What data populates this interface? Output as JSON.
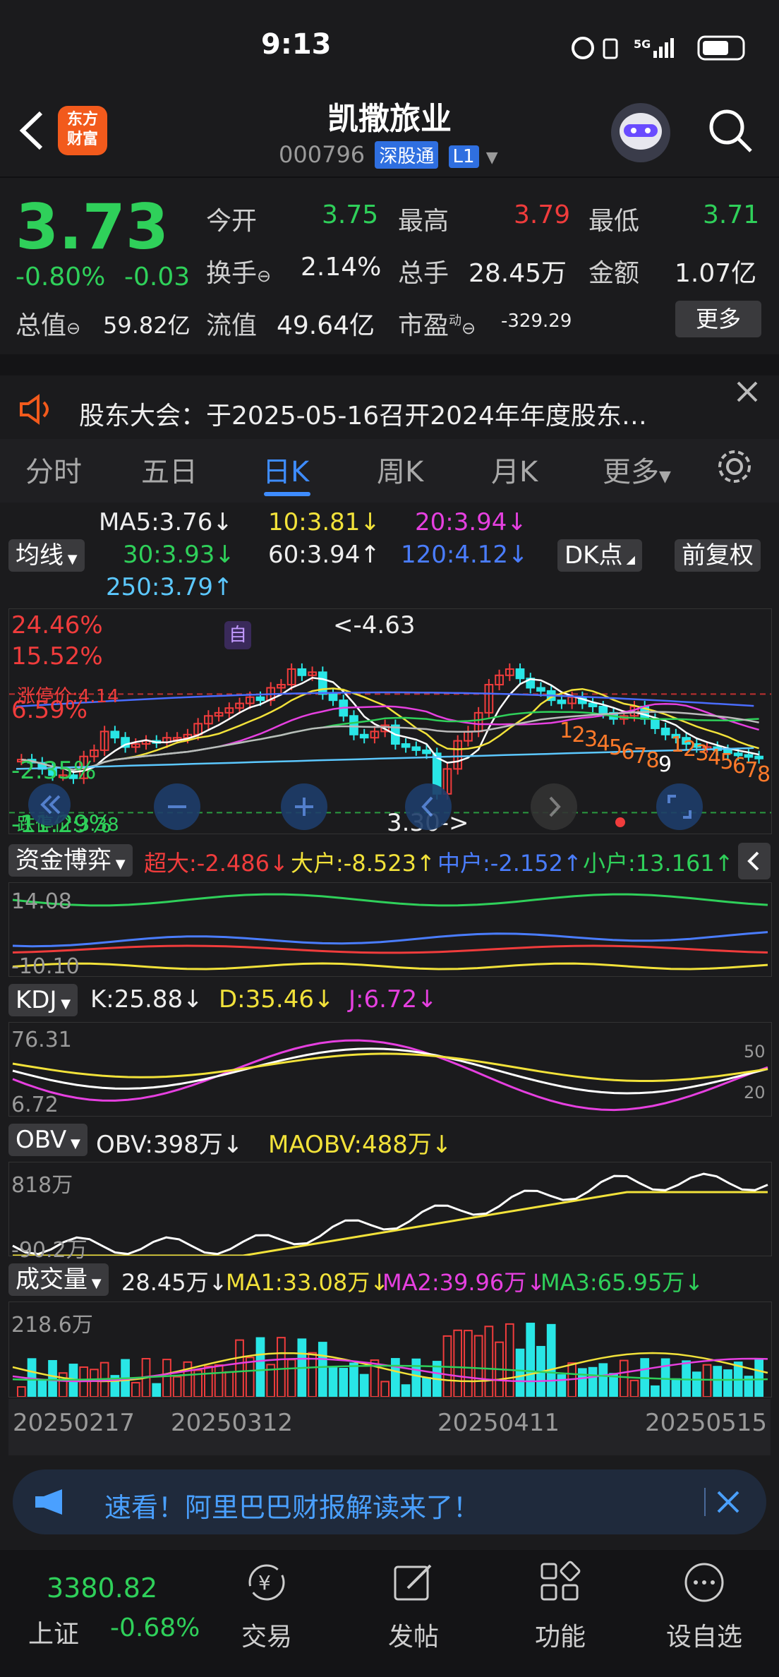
{
  "status": {
    "time": "9:13"
  },
  "header": {
    "logo_line1": "东方",
    "logo_line2": "财富",
    "name": "凯撒旅业",
    "code": "000796",
    "tag_connect": "深股通",
    "tag_level": "L1"
  },
  "quote": {
    "price": "3.73",
    "change_pct": "-0.80%",
    "change": "-0.03",
    "open_label": "今开",
    "open": "3.75",
    "high_label": "最高",
    "high": "3.79",
    "low_label": "最低",
    "low": "3.71",
    "turnover_label": "换手",
    "turnover": "2.14%",
    "volume_label": "总手",
    "volume": "28.45万",
    "amount_label": "金额",
    "amount": "1.07亿",
    "mktcap_label": "总值",
    "mktcap": "59.82亿",
    "float_label": "流值",
    "float": "49.64亿",
    "pe_label": "市盈",
    "pe_sup": "动",
    "pe": "-329.29",
    "more_label": "更多"
  },
  "notice": {
    "text": "股东大会：于2025-05-16召开2024年年度股东…"
  },
  "tabs": [
    "分时",
    "五日",
    "日K",
    "周K",
    "月K",
    "更多"
  ],
  "active_tab": "日K",
  "ma": {
    "selector": "均线",
    "ma5": "MA5:3.76↓",
    "ma10": "10:3.81↓",
    "ma20": "20:3.94↓",
    "ma30": "30:3.93↓",
    "ma60": "60:3.94↑",
    "ma120": "120:4.12↓",
    "ma250": "250:3.79↑",
    "dk_label": "DK点",
    "adjust_label": "前复权"
  },
  "kline": {
    "pct_labels": [
      "24.46%",
      "15.52%",
      "6.59%",
      "-2.35%",
      "-11.29%"
    ],
    "limit_up": "涨停价:4.14",
    "limit_down": "跌停价:3.38",
    "self_mark": "自",
    "max_label": "<-4.63",
    "min_label": "3.30->",
    "dk_points": [
      "1",
      "2",
      "3",
      "4",
      "5",
      "6",
      "7",
      "8",
      "9",
      "1",
      "2",
      "3",
      "4",
      "5",
      "6",
      "7",
      "8"
    ]
  },
  "capital": {
    "selector": "资金博弈",
    "super": "超大:-2.486↓",
    "large": "大户:-8.523↑",
    "medium": "中户:-2.152↑",
    "small": "小户:13.161↑",
    "ymax": "14.08",
    "ymin": "-10.10"
  },
  "kdj": {
    "selector": "KDJ",
    "k": "K:25.88↓",
    "d": "D:35.46↓",
    "j": "J:6.72↓",
    "ymax": "76.31",
    "ymin": "6.72",
    "level_50": "50",
    "level_20": "20"
  },
  "obv": {
    "selector": "OBV",
    "obv": "OBV:398万↓",
    "maobv": "MAOBV:488万↓",
    "ymax": "818万",
    "ymin": "-90.2万"
  },
  "vol": {
    "selector": "成交量",
    "vol": "28.45万↓",
    "ma1": "MA1:33.08万↓",
    "ma2": "MA2:39.96万↓",
    "ma3": "MA3:65.95万↓",
    "ymax": "218.6万"
  },
  "dates": [
    "20250217",
    "20250312",
    "20250411",
    "20250515"
  ],
  "ad": {
    "text": "速看！阿里巴巴财报解读来了！"
  },
  "bottom": {
    "index_value": "3380.82",
    "index_name": "上证",
    "index_change": "-0.68%",
    "trade": "交易",
    "post": "发帖",
    "function": "功能",
    "watch": "设自选"
  },
  "colors": {
    "up": "#f03c3c",
    "down": "#2fd05a",
    "accent": "#3e8cff",
    "cyan": "#29e6e6"
  },
  "chart_data": {
    "type": "candlestick",
    "title": "",
    "price_range": [
      3.3,
      4.63
    ],
    "candles_close_approx": [
      3.72,
      3.7,
      3.66,
      3.62,
      3.62,
      3.6,
      3.74,
      3.78,
      3.9,
      3.86,
      3.8,
      3.82,
      3.84,
      3.83,
      3.86,
      3.86,
      3.88,
      3.95,
      4.0,
      4.02,
      4.05,
      4.08,
      4.12,
      4.1,
      4.18,
      4.2,
      4.3,
      4.26,
      4.28,
      4.14,
      4.1,
      4.0,
      3.88,
      3.86,
      3.9,
      3.94,
      3.82,
      3.8,
      3.78,
      3.76,
      3.5,
      3.66,
      3.84,
      3.9,
      4.02,
      4.2,
      4.26,
      4.3,
      4.24,
      4.18,
      4.16,
      4.1,
      4.08,
      4.12,
      4.08,
      4.06,
      4.02,
      3.98,
      4.0,
      4.06,
      3.98,
      3.92,
      3.88,
      3.86,
      3.82,
      3.8,
      3.8,
      3.78,
      3.76,
      3.75,
      3.74,
      3.73
    ]
  }
}
